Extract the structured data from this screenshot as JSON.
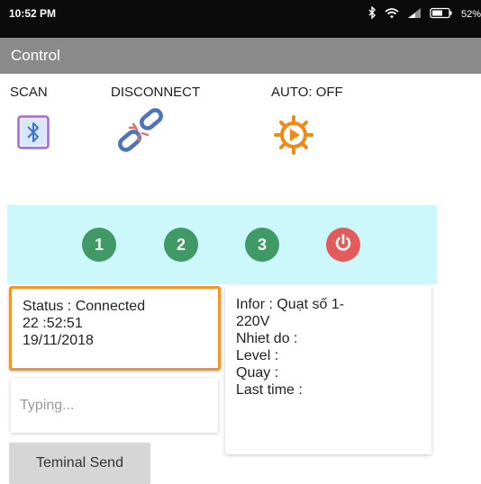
{
  "status_bar": {
    "time": "10:52 PM",
    "battery": "52%",
    "icons": [
      "bluetooth-icon",
      "wifi-icon",
      "signal-icon",
      "battery-icon"
    ]
  },
  "app": {
    "title": "Control"
  },
  "commands": {
    "scan": {
      "label": "SCAN",
      "icon": "bluetooth-icon"
    },
    "disconnect": {
      "label": "DISCONNECT",
      "icon": "broken-link-icon"
    },
    "auto": {
      "label": "AUTO: OFF",
      "icon": "auto-sun-play-icon"
    }
  },
  "speed_buttons": [
    {
      "label": "1",
      "color": "#3f9a66"
    },
    {
      "label": "2",
      "color": "#3f9a66"
    },
    {
      "label": "3",
      "color": "#3f9a66"
    }
  ],
  "power_button": {
    "icon": "power-icon",
    "color": "#e55a5a"
  },
  "status_box": {
    "line1": "Status : Connected",
    "line2": "22 :52:51",
    "line3": "19/11/2018"
  },
  "info_box": {
    "line1": "Infor : Quạt số 1-",
    "line2": "220V",
    "line3": "Nhiet do :",
    "line4": "Level :",
    "line5": "Quay :",
    "line6": "Last time :"
  },
  "input": {
    "placeholder": "Typing...",
    "value": ""
  },
  "send_button": {
    "label": "Teminal Send"
  },
  "colors": {
    "status_bar": "#0b0b0b",
    "title_bar": "#8a8a8a",
    "panel_bg": "#ccf7fb",
    "status_border": "#f0962c",
    "button_bg": "#d6d6d6"
  }
}
